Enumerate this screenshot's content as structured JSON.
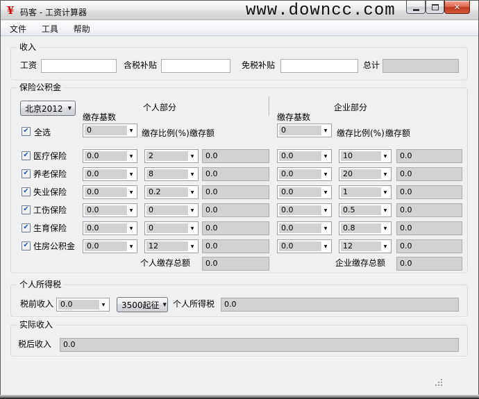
{
  "window": {
    "icon_glyph": "¥",
    "title": "码客 - 工资计算器",
    "watermark": "www.downcc.com"
  },
  "menu": {
    "items": [
      "文件",
      "工具",
      "帮助"
    ]
  },
  "icons": {
    "app": "yen-icon",
    "minimize": "minimize-icon",
    "maximize": "maximize-icon",
    "close": "close-icon",
    "dropdown_arrow": "▼",
    "checkbox_check": "✔"
  },
  "colors": {
    "app_icon": "#cc0000",
    "close_button": "#c23b22",
    "checkbox_check": "#2157ad",
    "watermark": "#101010"
  },
  "income": {
    "legend": "收入",
    "salary_label": "工资",
    "salary_value": "",
    "taxable_subsidy_label": "含税补贴",
    "taxable_subsidy_value": "",
    "taxfree_subsidy_label": "免税补贴",
    "taxfree_subsidy_value": "",
    "total_label": "总计",
    "total_value": ""
  },
  "insurance": {
    "legend": "保险公积金",
    "region_selected": "北京2012",
    "personal_header": "个人部分",
    "enterprise_header": "企业部分",
    "select_all_label": "全选",
    "select_all_checked": true,
    "base_label": "缴存基数",
    "ratio_label": "缴存比例(%)",
    "amount_label": "缴存额",
    "personal_base_value": "0",
    "enterprise_base_value": "0",
    "rows": [
      {
        "label": "医疗保险",
        "checked": true,
        "p_base": "0.0",
        "p_ratio": "2",
        "p_amount": "0.0",
        "e_base": "0.0",
        "e_ratio": "10",
        "e_amount": "0.0"
      },
      {
        "label": "养老保险",
        "checked": true,
        "p_base": "0.0",
        "p_ratio": "8",
        "p_amount": "0.0",
        "e_base": "0.0",
        "e_ratio": "20",
        "e_amount": "0.0"
      },
      {
        "label": "失业保险",
        "checked": true,
        "p_base": "0.0",
        "p_ratio": "0.2",
        "p_amount": "0.0",
        "e_base": "0.0",
        "e_ratio": "1",
        "e_amount": "0.0"
      },
      {
        "label": "工伤保险",
        "checked": true,
        "p_base": "0.0",
        "p_ratio": "0",
        "p_amount": "0.0",
        "e_base": "0.0",
        "e_ratio": "0.5",
        "e_amount": "0.0"
      },
      {
        "label": "生育保险",
        "checked": true,
        "p_base": "0.0",
        "p_ratio": "0",
        "p_amount": "0.0",
        "e_base": "0.0",
        "e_ratio": "0.8",
        "e_amount": "0.0"
      },
      {
        "label": "住房公积金",
        "checked": true,
        "p_base": "0.0",
        "p_ratio": "12",
        "p_amount": "0.0",
        "e_base": "0.0",
        "e_ratio": "12",
        "e_amount": "0.0"
      }
    ],
    "personal_total_label": "个人缴存总额",
    "personal_total_value": "0.0",
    "enterprise_total_label": "企业缴存总额",
    "enterprise_total_value": "0.0"
  },
  "tax": {
    "legend": "个人所得税",
    "pretax_label": "税前收入",
    "pretax_value": "0.0",
    "threshold_value": "3500起征",
    "result_label": "个人所得税",
    "result_value": "0.0"
  },
  "net": {
    "legend": "实际收入",
    "label": "税后收入",
    "value": "0.0"
  }
}
